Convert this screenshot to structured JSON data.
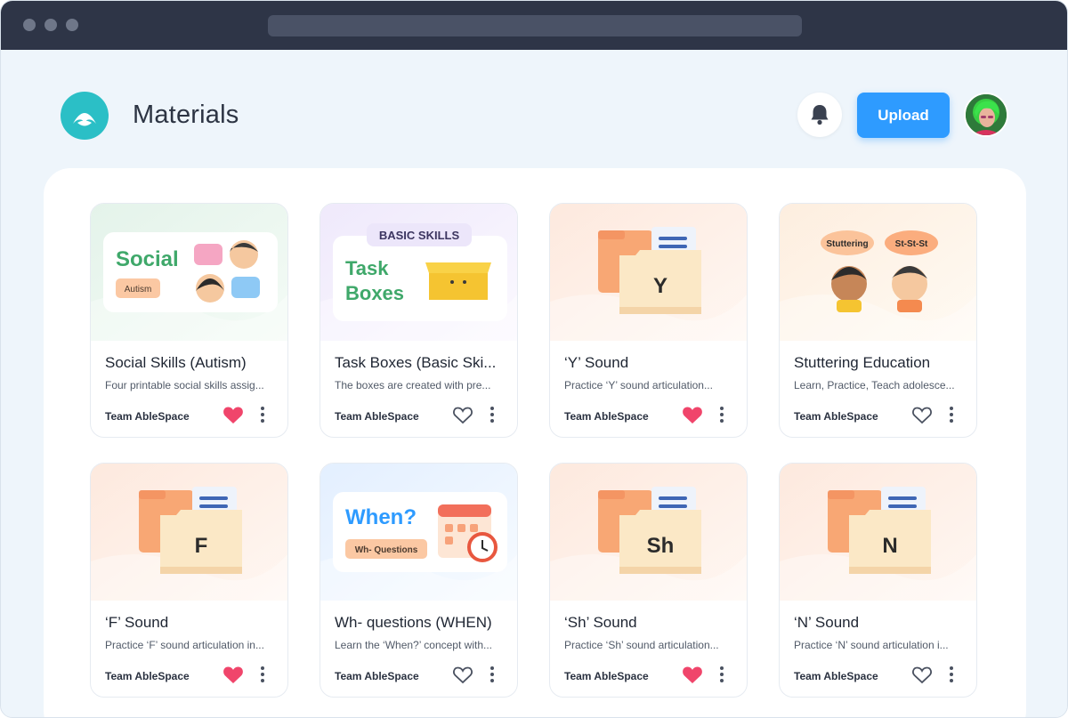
{
  "header": {
    "title": "Materials",
    "upload_label": "Upload"
  },
  "colors": {
    "brand": "#2bbfc6",
    "primary": "#2e9bff",
    "favorite": "#f0456b"
  },
  "cards": [
    {
      "title": "Social Skills (Autism)",
      "description": "Four printable social skills assig...",
      "author": "Team AbleSpace",
      "favorited": true,
      "thumb": {
        "kind": "social",
        "text1": "Social",
        "text2": "Autism"
      }
    },
    {
      "title": "Task Boxes (Basic Ski...",
      "description": "The boxes are created with pre...",
      "author": "Team AbleSpace",
      "favorited": false,
      "thumb": {
        "kind": "taskbox",
        "text1": "Task",
        "text2": "Boxes",
        "badge": "BASIC SKILLS"
      }
    },
    {
      "title": "‘Y’ Sound",
      "description": "Practice ‘Y’ sound articulation...",
      "author": "Team AbleSpace",
      "favorited": true,
      "thumb": {
        "kind": "folder",
        "letter": "Y"
      }
    },
    {
      "title": "Stuttering Education",
      "description": "Learn, Practice, Teach adolesce...",
      "author": "Team AbleSpace",
      "favorited": false,
      "thumb": {
        "kind": "stutter",
        "text1": "Stuttering",
        "text2": "St-St-St"
      }
    },
    {
      "title": "‘F’ Sound",
      "description": "Practice ‘F’ sound articulation in...",
      "author": "Team AbleSpace",
      "favorited": true,
      "thumb": {
        "kind": "folder",
        "letter": "F"
      }
    },
    {
      "title": "Wh- questions (WHEN)",
      "description": "Learn the ‘When?’ concept with...",
      "author": "Team AbleSpace",
      "favorited": false,
      "thumb": {
        "kind": "when",
        "text1": "When?",
        "text2": "Wh- Questions"
      }
    },
    {
      "title": "‘Sh’ Sound",
      "description": "Practice ‘Sh’ sound articulation...",
      "author": "Team AbleSpace",
      "favorited": true,
      "thumb": {
        "kind": "folder",
        "letter": "Sh"
      }
    },
    {
      "title": "‘N’ Sound",
      "description": "Practice ‘N’ sound articulation i...",
      "author": "Team AbleSpace",
      "favorited": false,
      "thumb": {
        "kind": "folder",
        "letter": "N"
      }
    }
  ]
}
